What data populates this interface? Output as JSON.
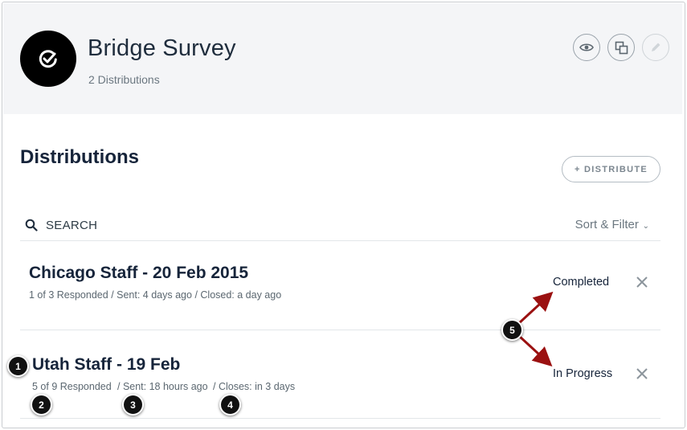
{
  "survey": {
    "title": "Bridge Survey",
    "distribution_count": "2 Distributions",
    "icon": "checkmark-badge-icon"
  },
  "header_actions": [
    {
      "name": "preview",
      "icon": "eye-icon"
    },
    {
      "name": "copy",
      "icon": "copy-icon"
    },
    {
      "name": "edit",
      "icon": "pencil-icon",
      "disabled": true
    }
  ],
  "section": {
    "title": "Distributions",
    "distribute_label": "+ DISTRIBUTE"
  },
  "search": {
    "label": "SEARCH",
    "sort_filter_label": "Sort & Filter"
  },
  "distributions": [
    {
      "title": "Chicago Staff - 20 Feb 2015",
      "responded": "1 of 3 Responded",
      "sent": "/ Sent: 4 days ago",
      "closed": "/ Closed: a day ago",
      "status": "Completed"
    },
    {
      "title": "Utah Staff - 19 Feb",
      "responded": "5 of 9 Responded",
      "sent": "/ Sent: 18 hours ago",
      "closed": "/ Closes: in 3 days",
      "status": "In Progress"
    }
  ],
  "callouts": [
    "1",
    "2",
    "3",
    "4",
    "5"
  ],
  "colors": {
    "header_bg": "#f4f5f7",
    "title_text": "#16243a",
    "annotation_arrow": "#9b1111",
    "callout_bg": "#111111"
  }
}
